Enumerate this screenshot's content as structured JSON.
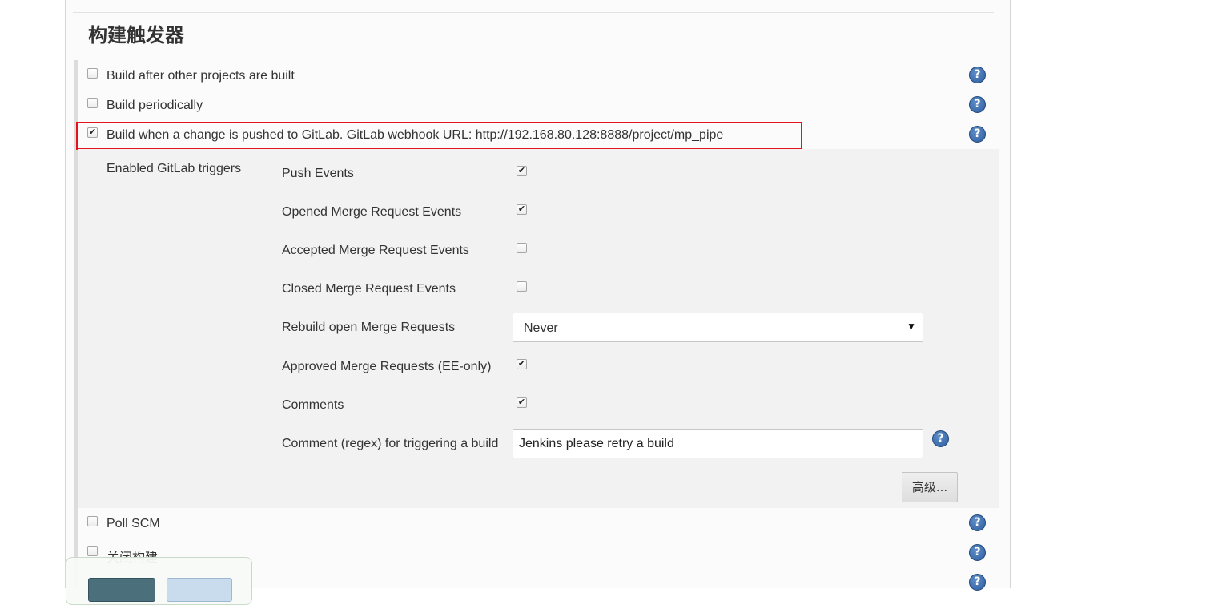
{
  "section": {
    "title": "构建触发器"
  },
  "triggers": [
    {
      "label": "Build after other projects are built",
      "checked": false
    },
    {
      "label": "Build periodically",
      "checked": false
    },
    {
      "label": "Build when a change is pushed to GitLab. GitLab webhook URL: http://192.168.80.128:8888/project/mp_pipe",
      "checked": true
    },
    {
      "label": "Poll SCM",
      "checked": false
    },
    {
      "label": "关闭构建",
      "checked": false
    }
  ],
  "gitlab": {
    "enabled_label": "Enabled GitLab triggers",
    "options": [
      {
        "label": "Push Events",
        "checked": true
      },
      {
        "label": "Opened Merge Request Events",
        "checked": true
      },
      {
        "label": "Accepted Merge Request Events",
        "checked": false
      },
      {
        "label": "Closed Merge Request Events",
        "checked": false
      },
      {
        "label": "Rebuild open Merge Requests"
      },
      {
        "label": "Approved Merge Requests (EE-only)",
        "checked": true
      },
      {
        "label": "Comments",
        "checked": true
      },
      {
        "label": "Comment (regex) for triggering a build"
      }
    ],
    "rebuild_select_value": "Never",
    "comment_regex_value": "Jenkins please retry a build",
    "advanced_button": "高级..."
  },
  "icons": {
    "help": "help-icon",
    "help_glyph": "?",
    "check_glyph": "✔",
    "dropdown_glyph": "▼"
  },
  "colors": {
    "highlight_border": "#e3131f",
    "subpanel_bg": "#f2f2f2",
    "save_button": "#4c6f7c",
    "apply_button": "#c9dcee"
  }
}
